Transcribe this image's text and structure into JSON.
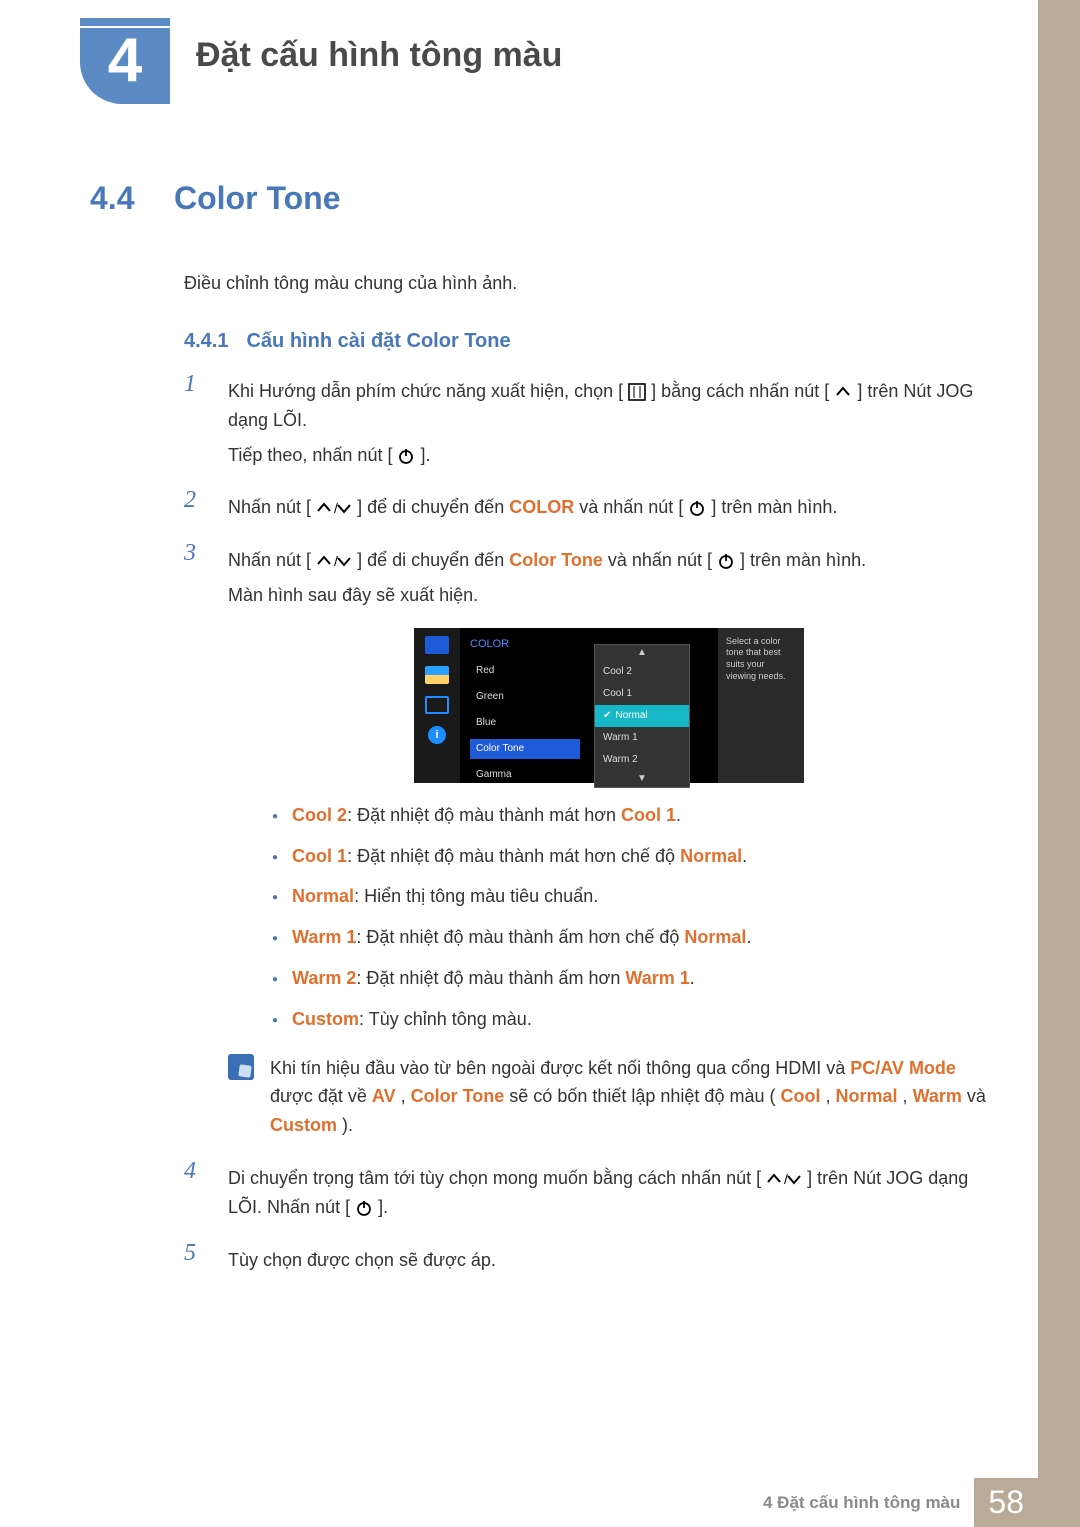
{
  "chapter": {
    "number": "4",
    "title": "Đặt cấu hình tông màu"
  },
  "section": {
    "number": "4.4",
    "title": "Color Tone",
    "intro": "Điều chỉnh tông màu chung của hình ảnh."
  },
  "subsection": {
    "number": "4.4.1",
    "title": "Cấu hình cài đặt Color Tone"
  },
  "steps": {
    "s1_a": "Khi Hướng dẫn phím chức năng xuất hiện, chọn [",
    "s1_b": "] bằng cách nhấn nút [",
    "s1_c": "] trên Nút JOG dạng LÕI.",
    "s1_d": "Tiếp theo, nhấn nút [",
    "s1_e": "].",
    "s2_a": "Nhấn nút [",
    "s2_b": "] để di chuyển đến ",
    "s2_c": " và nhấn nút [",
    "s2_d": "] trên màn hình.",
    "s3_a": "Nhấn nút [",
    "s3_b": "] để di chuyển đến ",
    "s3_c": " và nhấn nút [",
    "s3_d": "] trên màn hình.",
    "s3_e": "Màn hình sau đây sẽ xuất hiện.",
    "s4_a": "Di chuyển trọng tâm tới tùy chọn mong muốn bằng cách nhấn nút [",
    "s4_b": "] trên Nút JOG dạng LÕI. Nhấn nút [",
    "s4_c": "].",
    "s5": "Tùy chọn được chọn sẽ được áp."
  },
  "kw": {
    "COLOR": "COLOR",
    "ColorTone": "Color Tone",
    "Cool2": "Cool 2",
    "Cool1": "Cool 1",
    "Normal": "Normal",
    "Warm1": "Warm 1",
    "Warm2": "Warm 2",
    "Custom": "Custom",
    "PCAV": "PC/AV Mode",
    "AV": "AV",
    "Cool": "Cool",
    "Warm": "Warm"
  },
  "bullets": {
    "b1": ": Đặt nhiệt độ màu thành mát hơn ",
    "b1_end": ".",
    "b2": ": Đặt nhiệt độ màu thành mát hơn chế độ ",
    "b2_end": ".",
    "b3": ": Hiển thị tông màu tiêu chuẩn.",
    "b4": ": Đặt nhiệt độ màu thành ấm hơn chế độ ",
    "b4_end": ".",
    "b5": ": Đặt nhiệt độ màu thành ấm hơn ",
    "b5_end": ".",
    "b6": ": Tùy chỉnh tông màu."
  },
  "note": {
    "a": "Khi tín hiệu đầu vào từ bên ngoài được kết nối thông qua cổng HDMI và ",
    "b": " được đặt về ",
    "c": ",",
    "d": " sẽ có bốn thiết lập nhiệt độ màu (",
    "e": ", ",
    "f": " và ",
    "g": ")."
  },
  "osd": {
    "category": "COLOR",
    "items": [
      "Red",
      "Green",
      "Blue",
      "Color Tone",
      "Gamma"
    ],
    "dropdown": [
      "Cool 2",
      "Cool 1",
      "Normal",
      "Warm 1",
      "Warm 2"
    ],
    "selected": "Normal",
    "desc": "Select a color tone that best suits your viewing needs."
  },
  "footer": {
    "text": "4 Đặt cấu hình tông màu",
    "page": "58"
  }
}
